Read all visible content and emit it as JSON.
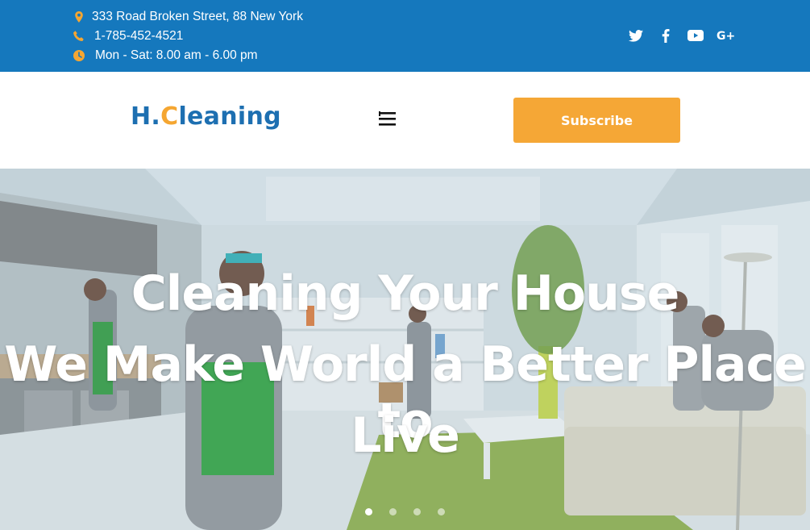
{
  "topbar": {
    "address": "333 Road Broken Street, 88 New York",
    "phone": "1-785-452-4521",
    "hours": "Mon - Sat: 8.00 am - 6.00 pm",
    "icon_color": "#f5a631",
    "background": "#1578bd",
    "icons": {
      "address": "map-pin-icon",
      "phone": "phone-icon",
      "hours": "clock-icon"
    },
    "social": [
      "twitter-icon",
      "facebook-icon",
      "youtube-icon",
      "google-plus-icon"
    ]
  },
  "header": {
    "logo_prefix": "H.",
    "logo_accent": "C",
    "logo_rest": "leaning",
    "menu_icon": "hamburger-menu-icon",
    "subscribe_label": "Subscribe",
    "subscribe_color": "#f5a736"
  },
  "hero": {
    "line1": "Cleaning Your House",
    "line2": "We Make World a Better Place to",
    "line3": "Live",
    "slides": 4,
    "active_slide": 1
  }
}
